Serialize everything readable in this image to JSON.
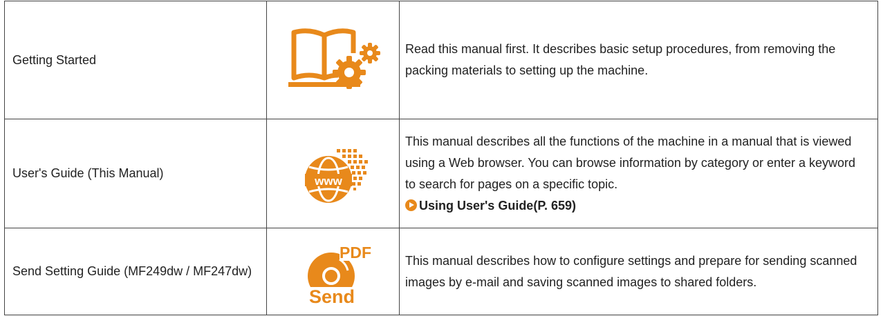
{
  "manuals": [
    {
      "name": "Getting Started",
      "icon": "book-gear-icon",
      "description": "Read this manual first. It describes basic setup procedures, from removing the packing materials to setting up the machine."
    },
    {
      "name": "User's Guide (This Manual)",
      "icon": "www-globe-icon",
      "description": "This manual describes all the functions of the machine in a manual that is viewed using a Web browser. You can browse information by category or enter a keyword to search for pages on a specific topic.",
      "link_text": "Using User's Guide(P. 659)"
    },
    {
      "name": "Send Setting Guide (MF249dw / MF247dw)",
      "icon": "pdf-send-icon",
      "icon_text_top": "PDF",
      "icon_text_bottom": "Send",
      "description": "This manual describes how to configure settings and prepare for sending scanned images by e-mail and saving scanned images to shared folders."
    }
  ],
  "colors": {
    "icon_orange": "#e8891b",
    "border": "#444444",
    "text": "#222222"
  }
}
